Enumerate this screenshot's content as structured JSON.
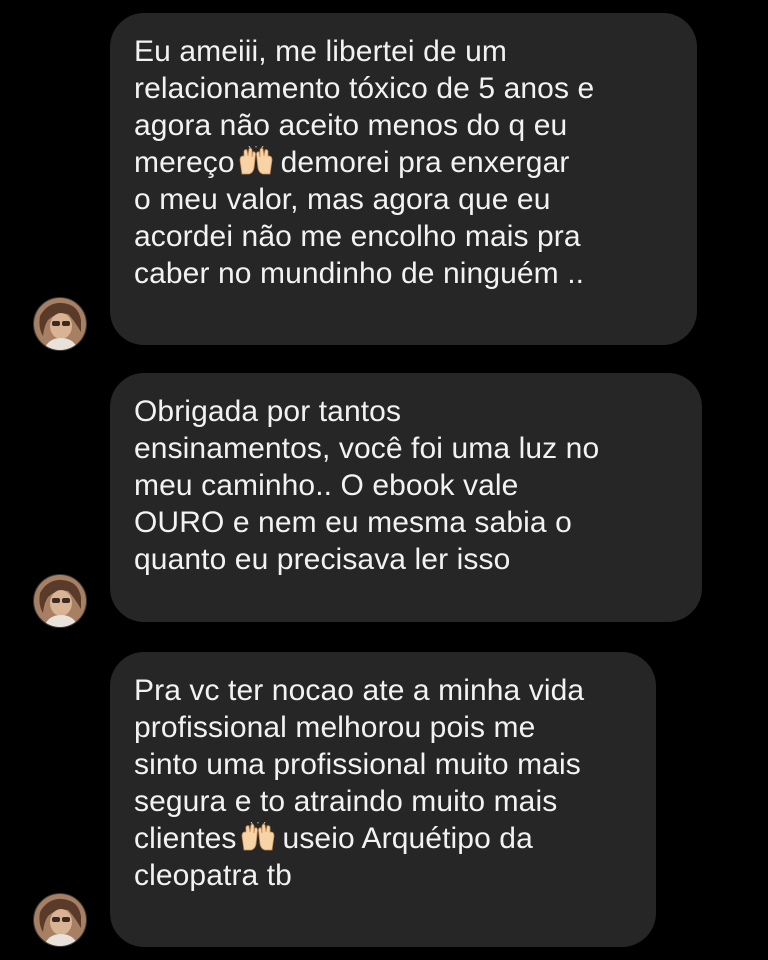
{
  "messages": [
    {
      "avatar_icon": "profile-photo",
      "text_before_emoji": "Eu ameiii, me libertei de um\nrelacionamento tóxico de 5 anos e\nagora não aceito menos do q eu\nmereço",
      "emoji": "raising-hands-icon",
      "text_after_emoji": "demorei pra enxergar\no meu valor, mas agora que eu\nacordei não me encolho mais pra\ncaber no mundinho de ninguém .."
    },
    {
      "avatar_icon": "profile-photo",
      "text": "Obrigada por tantos\nensinamentos, você foi uma luz no\nmeu caminho.. O ebook vale\nOURO e nem eu mesma sabia o\nquanto eu precisava ler isso"
    },
    {
      "avatar_icon": "profile-photo",
      "text_before_emoji": "Pra vc ter nocao ate a minha vida\nprofissional melhorou pois me\nsinto uma profissional muito mais\nsegura e to atraindo muito mais\nclientes",
      "emoji": "raising-hands-icon",
      "text_after_emoji": "useio Arquétipo da\ncleopatra tb"
    }
  ],
  "colors": {
    "background": "#000000",
    "bubble": "#262626",
    "text": "#f2f2f2"
  }
}
